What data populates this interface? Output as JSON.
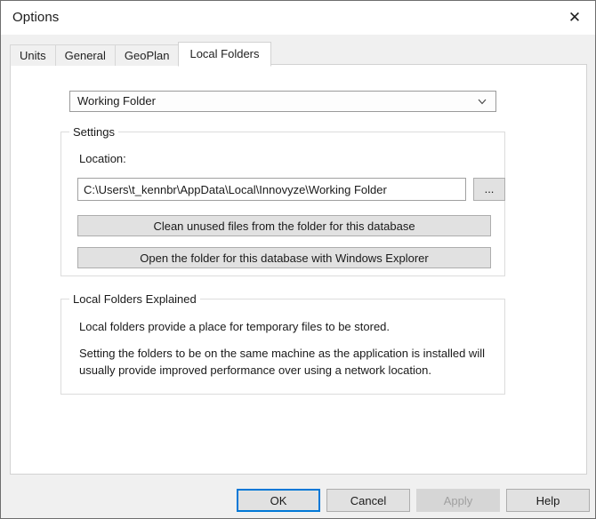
{
  "window": {
    "title": "Options",
    "close_icon": "close-icon",
    "close_glyph": "✕"
  },
  "tabs": [
    {
      "label": "Units",
      "active": false
    },
    {
      "label": "General",
      "active": false
    },
    {
      "label": "GeoPlan",
      "active": false
    },
    {
      "label": "Local Folders",
      "active": true
    }
  ],
  "folder_selector": {
    "selected": "Working Folder",
    "arrow_icon": "chevron-down-icon"
  },
  "settings": {
    "legend": "Settings",
    "location_label": "Location:",
    "location_value": "C:\\Users\\t_kennbr\\AppData\\Local\\Innovyze\\Working Folder",
    "browse_label": "...",
    "clean_label": "Clean unused files from the folder for this database",
    "open_explorer_label": "Open the folder for this database with Windows Explorer"
  },
  "explained": {
    "legend": "Local Folders Explained",
    "paragraph1": "Local folders provide a place for temporary files to be stored.",
    "paragraph2": "Setting the folders to be on the same machine as the application is installed will usually provide improved performance over using a network location."
  },
  "footer": {
    "ok_label": "OK",
    "cancel_label": "Cancel",
    "apply_label": "Apply",
    "help_label": "Help"
  },
  "colors": {
    "accent": "#0078d7",
    "dialog_background": "#f0f0f0",
    "panel_background": "#ffffff",
    "button_face": "#e1e1e1",
    "disabled_text": "#a0a0a0"
  }
}
